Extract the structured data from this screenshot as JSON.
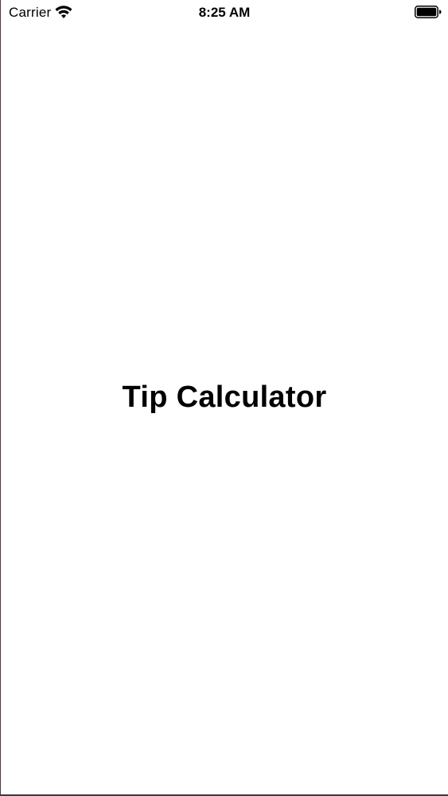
{
  "status_bar": {
    "carrier": "Carrier",
    "time": "8:25 AM",
    "icons": [
      "wifi-icon",
      "battery-icon"
    ]
  },
  "main": {
    "title": "Tip Calculator"
  },
  "colors": {
    "background": "#ffffff",
    "text": "#000000"
  }
}
